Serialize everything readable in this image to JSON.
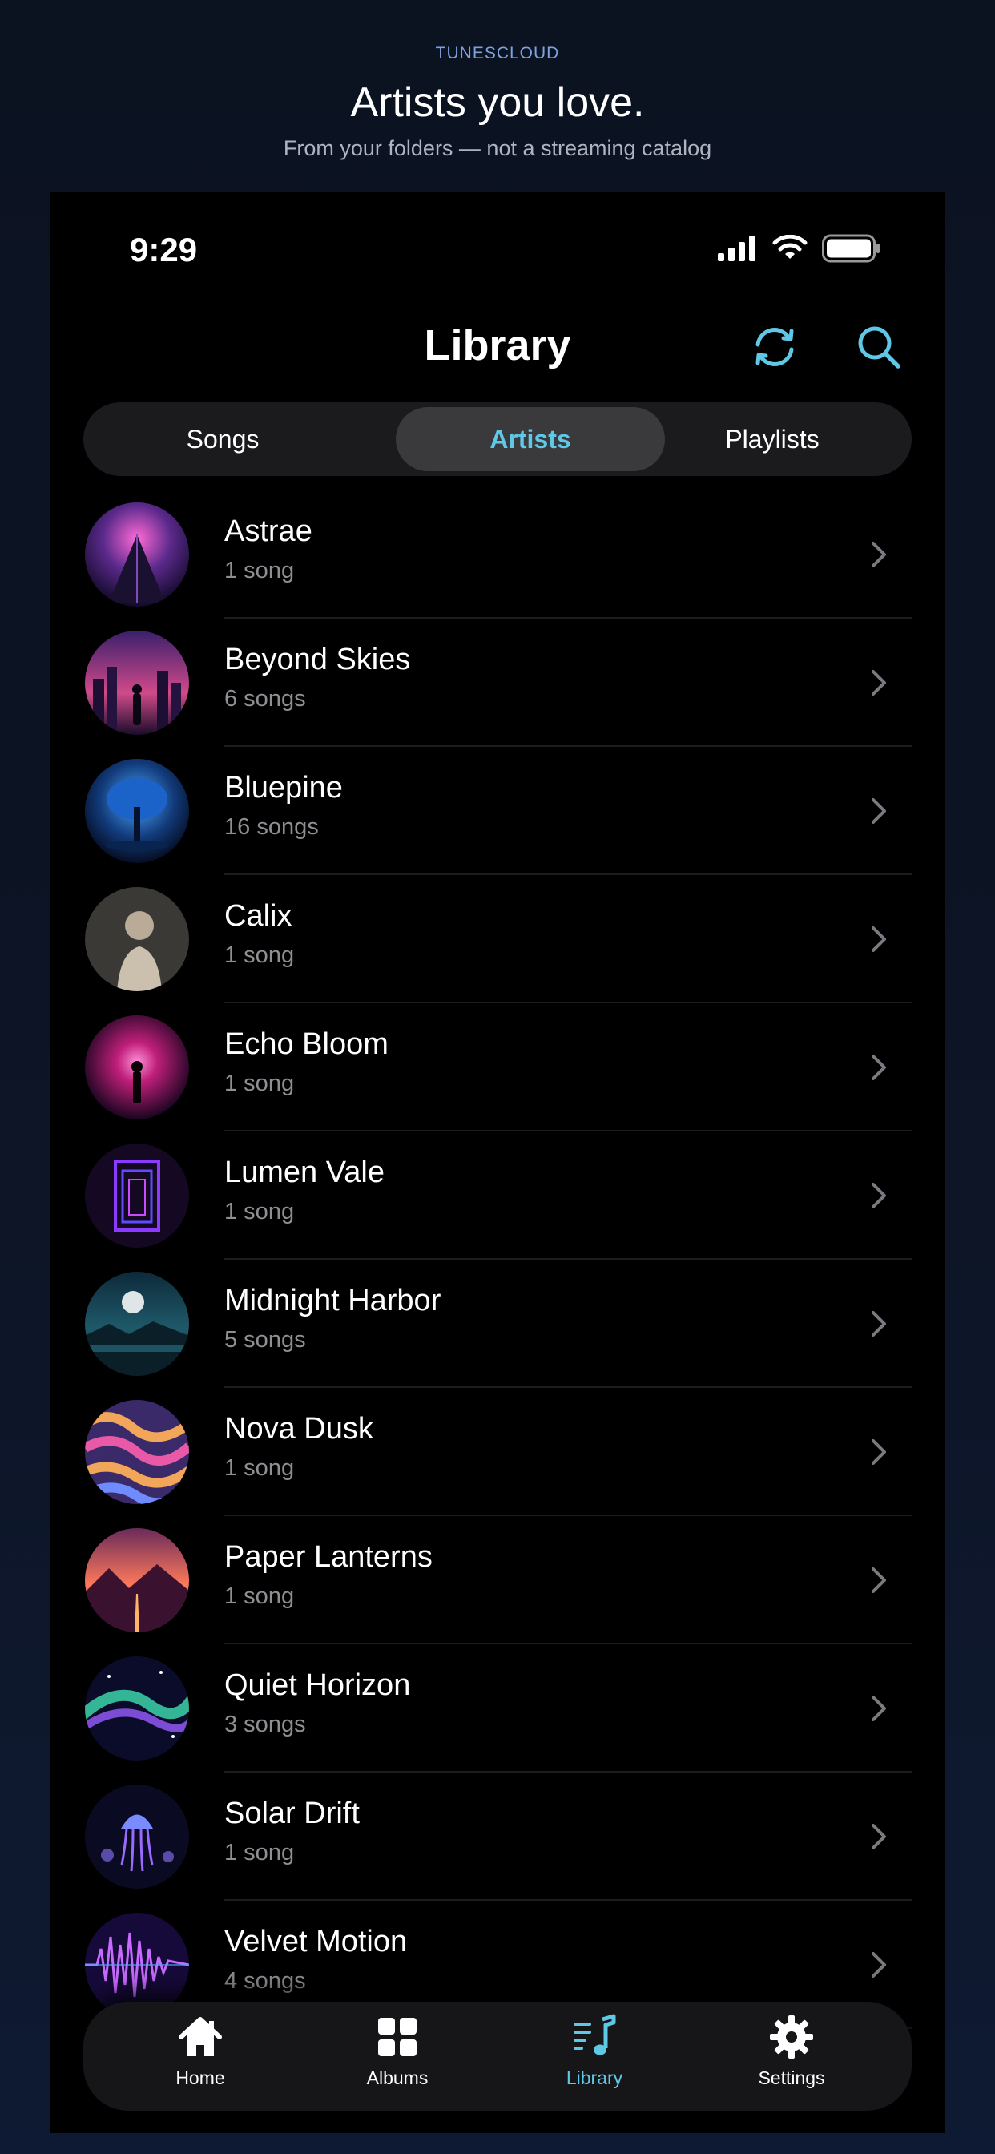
{
  "promo": {
    "brand": "TUNESCLOUD",
    "headline": "Artists you love.",
    "subline": "From your folders — not a streaming catalog"
  },
  "status_bar": {
    "time": "9:29",
    "icons": [
      "cellular-signal-icon",
      "wifi-icon",
      "battery-icon"
    ]
  },
  "header": {
    "title": "Library",
    "actions": [
      "sync-icon",
      "search-icon"
    ]
  },
  "segments": {
    "items": [
      "Songs",
      "Artists",
      "Playlists"
    ],
    "selected": "Artists"
  },
  "artists": [
    {
      "name": "Astrae",
      "count": "1 song"
    },
    {
      "name": "Beyond Skies",
      "count": "6 songs"
    },
    {
      "name": "Bluepine",
      "count": "16 songs"
    },
    {
      "name": "Calix",
      "count": "1 song"
    },
    {
      "name": "Echo Bloom",
      "count": "1 song"
    },
    {
      "name": "Lumen Vale",
      "count": "1 song"
    },
    {
      "name": "Midnight Harbor",
      "count": "5 songs"
    },
    {
      "name": "Nova Dusk",
      "count": "1 song"
    },
    {
      "name": "Paper Lanterns",
      "count": "1 song"
    },
    {
      "name": "Quiet Horizon",
      "count": "3 songs"
    },
    {
      "name": "Solar Drift",
      "count": "1 song"
    },
    {
      "name": "Velvet Motion",
      "count": "4 songs"
    }
  ],
  "tabbar": {
    "items": [
      {
        "label": "Home",
        "icon": "home-icon"
      },
      {
        "label": "Albums",
        "icon": "albums-grid-icon"
      },
      {
        "label": "Library",
        "icon": "library-music-icon"
      },
      {
        "label": "Settings",
        "icon": "gear-icon"
      }
    ],
    "active": "Library"
  },
  "colors": {
    "accent": "#5ec8e6",
    "background": "#000000",
    "page_background": "#0b1220"
  }
}
